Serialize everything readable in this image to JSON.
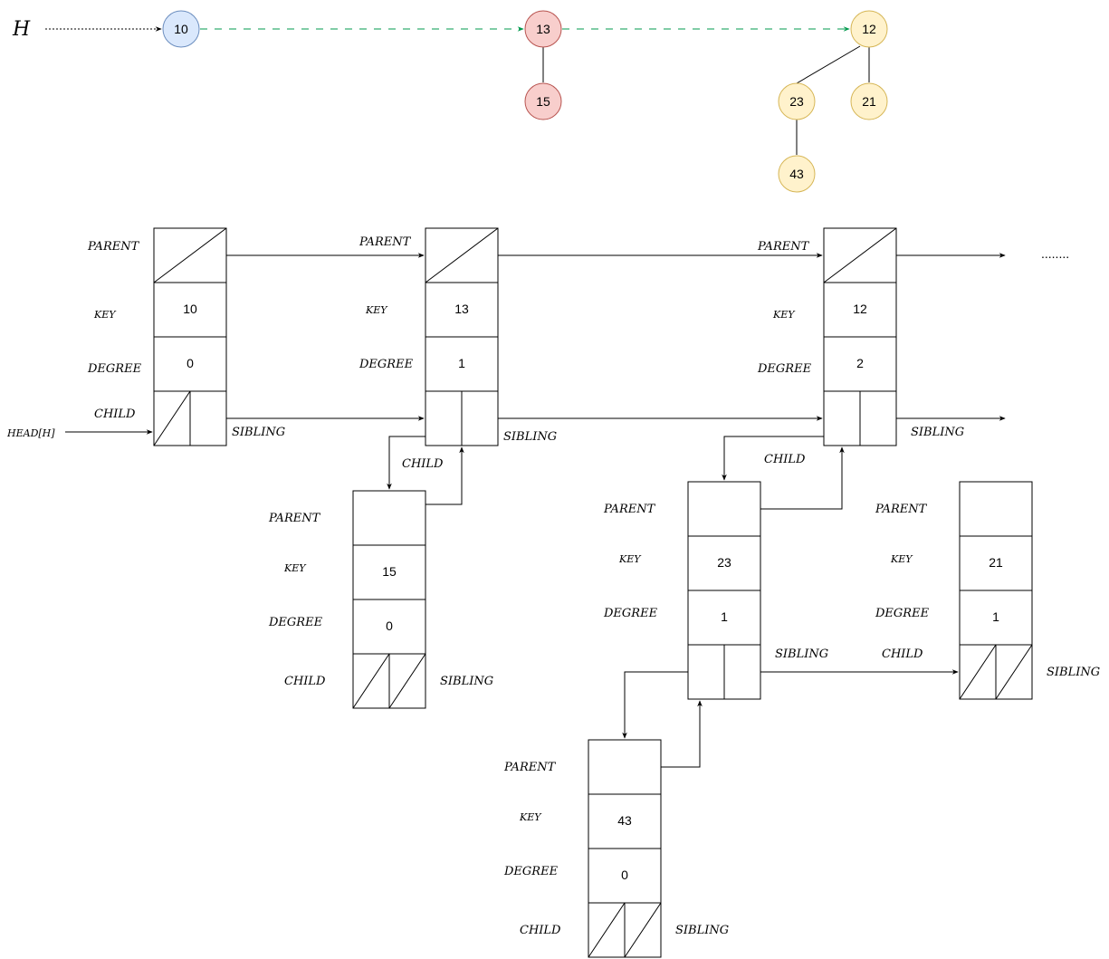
{
  "heap_label": "H",
  "head_label": "HEAD[H]",
  "ellipsis": "........",
  "colors": {
    "blue_fill": "#dae8fc",
    "blue_stroke": "#6c8ebf",
    "red_fill": "#f8cecc",
    "red_stroke": "#b85450",
    "yellow_fill": "#fff2cc",
    "yellow_stroke": "#d6b656",
    "green_link": "#00994d"
  },
  "tree_nodes": [
    {
      "id": "n10",
      "key": "10",
      "color": "blue"
    },
    {
      "id": "n13",
      "key": "13",
      "color": "red"
    },
    {
      "id": "n15",
      "key": "15",
      "color": "red"
    },
    {
      "id": "n12",
      "key": "12",
      "color": "yellow"
    },
    {
      "id": "n23",
      "key": "23",
      "color": "yellow"
    },
    {
      "id": "n21",
      "key": "21",
      "color": "yellow"
    },
    {
      "id": "n43",
      "key": "43",
      "color": "yellow"
    }
  ],
  "tree_edges": [
    {
      "from": "n13",
      "to": "n15"
    },
    {
      "from": "n12",
      "to": "n23"
    },
    {
      "from": "n12",
      "to": "n21"
    },
    {
      "from": "n23",
      "to": "n43"
    }
  ],
  "root_list_links": [
    {
      "from": "H",
      "to": "n10",
      "style": "dotted"
    },
    {
      "from": "n10",
      "to": "n13",
      "style": "dashed-green"
    },
    {
      "from": "n13",
      "to": "n12",
      "style": "dashed-green"
    }
  ],
  "field_labels": {
    "parent": "PARENT",
    "key": "KEY",
    "degree": "DEGREE",
    "child": "CHILD",
    "sibling": "SIBLING"
  },
  "records": [
    {
      "id": "r10",
      "key": "10",
      "degree": "0"
    },
    {
      "id": "r13",
      "key": "13",
      "degree": "1"
    },
    {
      "id": "r12",
      "key": "12",
      "degree": "2"
    },
    {
      "id": "r15",
      "key": "15",
      "degree": "0"
    },
    {
      "id": "r23",
      "key": "23",
      "degree": "1"
    },
    {
      "id": "r21",
      "key": "21",
      "degree": "1"
    },
    {
      "id": "r43",
      "key": "43",
      "degree": "0"
    }
  ]
}
